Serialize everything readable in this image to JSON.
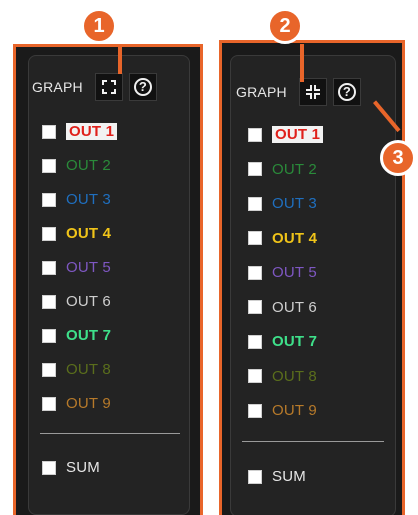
{
  "panel_left": {
    "header": {
      "title": "GRAPH",
      "icon1": "expand-icon",
      "icon2": "help-icon"
    },
    "channels": [
      {
        "label": "OUT 1",
        "color": "#e0201b",
        "bg": "#f2f2f2",
        "checked": false
      },
      {
        "label": "OUT 2",
        "color": "#2a8a3a",
        "checked": false
      },
      {
        "label": "OUT 3",
        "color": "#1f6fbf",
        "checked": false
      },
      {
        "label": "OUT 4",
        "color": "#f0c419",
        "checked": false
      },
      {
        "label": "OUT 5",
        "color": "#7e57c2",
        "checked": false
      },
      {
        "label": "OUT 6",
        "color": "#cfcfcf",
        "checked": false
      },
      {
        "label": "OUT 7",
        "color": "#3ee08a",
        "checked": false
      },
      {
        "label": "OUT 8",
        "color": "#5a6e1c",
        "checked": false
      },
      {
        "label": "OUT 9",
        "color": "#b77a2a",
        "checked": false
      }
    ],
    "sum": {
      "label": "SUM",
      "checked": false
    }
  },
  "panel_right": {
    "header": {
      "title": "GRAPH",
      "icon1": "collapse-icon",
      "icon2": "help-icon"
    },
    "channels": [
      {
        "label": "OUT 1",
        "color": "#e0201b",
        "bg": "#f2f2f2",
        "checked": false
      },
      {
        "label": "OUT 2",
        "color": "#2a8a3a",
        "checked": false
      },
      {
        "label": "OUT 3",
        "color": "#1f6fbf",
        "checked": false
      },
      {
        "label": "OUT 4",
        "color": "#f0c419",
        "checked": false
      },
      {
        "label": "OUT 5",
        "color": "#7e57c2",
        "checked": false
      },
      {
        "label": "OUT 6",
        "color": "#cfcfcf",
        "checked": false
      },
      {
        "label": "OUT 7",
        "color": "#3ee08a",
        "checked": false
      },
      {
        "label": "OUT 8",
        "color": "#5a6e1c",
        "checked": false
      },
      {
        "label": "OUT 9",
        "color": "#b77a2a",
        "checked": false
      }
    ],
    "sum": {
      "label": "SUM",
      "checked": false
    }
  },
  "callouts": [
    {
      "number": "1"
    },
    {
      "number": "2"
    },
    {
      "number": "3"
    }
  ],
  "theme": {
    "accent": "#e8652a",
    "panel_bg": "#1a1a1a"
  }
}
